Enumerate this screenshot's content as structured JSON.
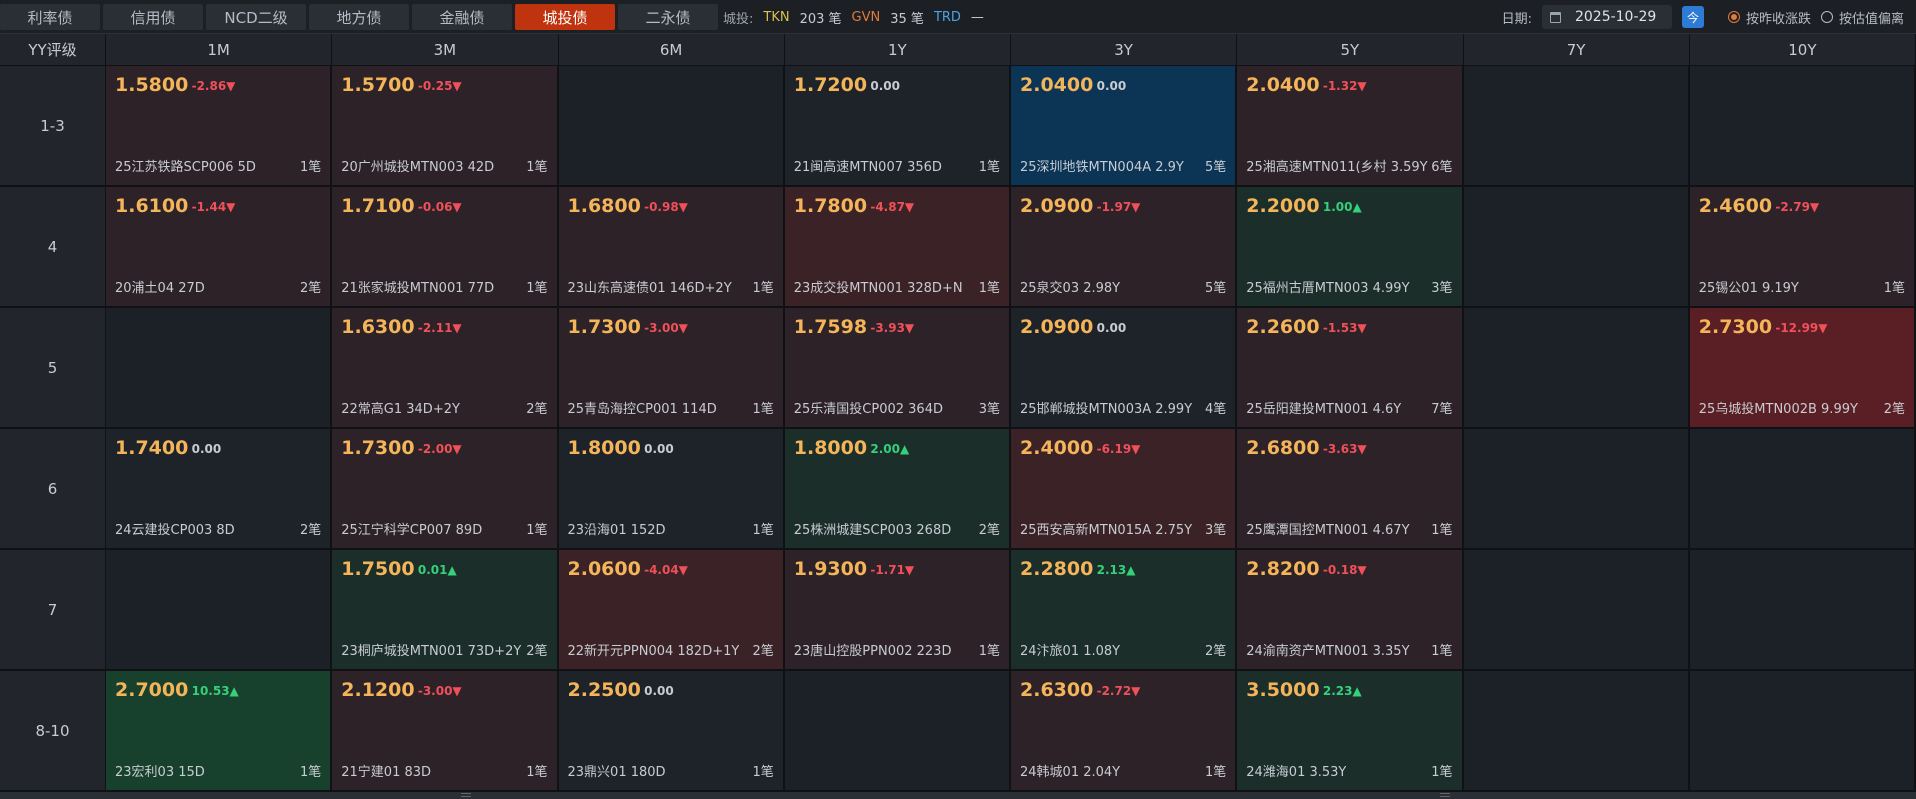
{
  "tabs": [
    {
      "label": "利率债",
      "active": false
    },
    {
      "label": "信用债",
      "active": false
    },
    {
      "label": "NCD二级",
      "active": false
    },
    {
      "label": "地方债",
      "active": false
    },
    {
      "label": "金融债",
      "active": false
    },
    {
      "label": "城投债",
      "active": true
    },
    {
      "label": "二永债",
      "active": false
    }
  ],
  "stats": {
    "label": "城投:",
    "tkn_label": "TKN",
    "tkn_value": "203 笔",
    "gvn_label": "GVN",
    "gvn_value": "35 笔",
    "trd_label": "TRD",
    "trd_value": "—"
  },
  "date": {
    "label": "日期:",
    "value": "2025-10-29",
    "today_label": "今",
    "option1": "按昨收涨跌",
    "option2": "按估值偏离"
  },
  "colors": {
    "accent": "#c0330f",
    "down": "#f0505a",
    "up": "#35d07a",
    "price": "#f4b55a"
  },
  "grid": {
    "corner_label": "YY评级",
    "columns": [
      "1M",
      "3M",
      "6M",
      "1Y",
      "3Y",
      "5Y",
      "7Y",
      "10Y"
    ],
    "rows": [
      {
        "label": "1-3",
        "cells": [
          {
            "val": "1.5800",
            "chg": "-2.86▼",
            "dir": "down",
            "tone": "neg-1",
            "name": "25江苏铁路SCP006 5D",
            "cnt": "1笔"
          },
          {
            "val": "1.5700",
            "chg": "-0.25▼",
            "dir": "down",
            "tone": "neg-1",
            "name": "20广州城投MTN003 42D",
            "cnt": "1笔"
          },
          null,
          {
            "val": "1.7200",
            "chg": "0.00",
            "dir": "flat",
            "tone": "zero",
            "name": "21闽高速MTN007 356D",
            "cnt": "1笔"
          },
          {
            "val": "2.0400",
            "chg": "0.00",
            "dir": "flat",
            "tone": "blue",
            "name": "25深圳地铁MTN004A 2.9Y",
            "cnt": "5笔"
          },
          {
            "val": "2.0400",
            "chg": "-1.32▼",
            "dir": "down",
            "tone": "neg-1",
            "name": "25湘高速MTN011(乡村 3.59Y",
            "cnt": "6笔"
          },
          null,
          null
        ]
      },
      {
        "label": "4",
        "cells": [
          {
            "val": "1.6100",
            "chg": "-1.44▼",
            "dir": "down",
            "tone": "neg-1",
            "name": "20浦土04 27D",
            "cnt": "2笔"
          },
          {
            "val": "1.7100",
            "chg": "-0.06▼",
            "dir": "down",
            "tone": "neg-1",
            "name": "21张家城投MTN001 77D",
            "cnt": "1笔"
          },
          {
            "val": "1.6800",
            "chg": "-0.98▼",
            "dir": "down",
            "tone": "neg-1",
            "name": "23山东高速债01 146D+2Y",
            "cnt": "1笔"
          },
          {
            "val": "1.7800",
            "chg": "-4.87▼",
            "dir": "down",
            "tone": "neg-2",
            "name": "23成交投MTN001 328D+N",
            "cnt": "1笔"
          },
          {
            "val": "2.0900",
            "chg": "-1.97▼",
            "dir": "down",
            "tone": "neg-1",
            "name": "25泉交03 2.98Y",
            "cnt": "5笔"
          },
          {
            "val": "2.2000",
            "chg": "1.00▲",
            "dir": "up",
            "tone": "pos-1",
            "name": "25福州古厝MTN003 4.99Y",
            "cnt": "3笔"
          },
          null,
          {
            "val": "2.4600",
            "chg": "-2.79▼",
            "dir": "down",
            "tone": "neg-1",
            "name": "25锡公01 9.19Y",
            "cnt": "1笔"
          }
        ]
      },
      {
        "label": "5",
        "cells": [
          null,
          {
            "val": "1.6300",
            "chg": "-2.11▼",
            "dir": "down",
            "tone": "neg-1",
            "name": "22常高G1 34D+2Y",
            "cnt": "2笔"
          },
          {
            "val": "1.7300",
            "chg": "-3.00▼",
            "dir": "down",
            "tone": "neg-1",
            "name": "25青岛海控CP001 114D",
            "cnt": "1笔"
          },
          {
            "val": "1.7598",
            "chg": "-3.93▼",
            "dir": "down",
            "tone": "neg-1",
            "name": "25乐清国投CP002 364D",
            "cnt": "3笔"
          },
          {
            "val": "2.0900",
            "chg": "0.00",
            "dir": "flat",
            "tone": "zero",
            "name": "25邯郸城投MTN003A 2.99Y",
            "cnt": "4笔"
          },
          {
            "val": "2.2600",
            "chg": "-1.53▼",
            "dir": "down",
            "tone": "neg-1",
            "name": "25岳阳建投MTN001 4.6Y",
            "cnt": "7笔"
          },
          null,
          {
            "val": "2.7300",
            "chg": "-12.99▼",
            "dir": "down",
            "tone": "neg-3",
            "name": "25乌城投MTN002B 9.99Y",
            "cnt": "2笔"
          }
        ]
      },
      {
        "label": "6",
        "cells": [
          {
            "val": "1.7400",
            "chg": "0.00",
            "dir": "flat",
            "tone": "zero",
            "name": "24云建投CP003 8D",
            "cnt": "2笔"
          },
          {
            "val": "1.7300",
            "chg": "-2.00▼",
            "dir": "down",
            "tone": "neg-1",
            "name": "25江宁科学CP007 89D",
            "cnt": "1笔"
          },
          {
            "val": "1.8000",
            "chg": "0.00",
            "dir": "flat",
            "tone": "zero",
            "name": "23沿海01 152D",
            "cnt": "1笔"
          },
          {
            "val": "1.8000",
            "chg": "2.00▲",
            "dir": "up",
            "tone": "pos-1",
            "name": "25株洲城建SCP003 268D",
            "cnt": "2笔"
          },
          {
            "val": "2.4000",
            "chg": "-6.19▼",
            "dir": "down",
            "tone": "neg-2",
            "name": "25西安高新MTN015A 2.75Y",
            "cnt": "3笔"
          },
          {
            "val": "2.6800",
            "chg": "-3.63▼",
            "dir": "down",
            "tone": "neg-1",
            "name": "25鹰潭国控MTN001 4.67Y",
            "cnt": "1笔"
          },
          null,
          null
        ]
      },
      {
        "label": "7",
        "cells": [
          null,
          {
            "val": "1.7500",
            "chg": "0.01▲",
            "dir": "up",
            "tone": "pos-1",
            "name": "23桐庐城投MTN001 73D+2Y",
            "cnt": "2笔"
          },
          {
            "val": "2.0600",
            "chg": "-4.04▼",
            "dir": "down",
            "tone": "neg-2",
            "name": "22新开元PPN004 182D+1Y",
            "cnt": "2笔"
          },
          {
            "val": "1.9300",
            "chg": "-1.71▼",
            "dir": "down",
            "tone": "neg-1",
            "name": "23唐山控股PPN002 223D",
            "cnt": "1笔"
          },
          {
            "val": "2.2800",
            "chg": "2.13▲",
            "dir": "up",
            "tone": "pos-1",
            "name": "24汴旅01 1.08Y",
            "cnt": "2笔"
          },
          {
            "val": "2.8200",
            "chg": "-0.18▼",
            "dir": "down",
            "tone": "neg-1",
            "name": "24渝南资产MTN001 3.35Y",
            "cnt": "1笔"
          },
          null,
          null
        ]
      },
      {
        "label": "8-10",
        "cells": [
          {
            "val": "2.7000",
            "chg": "10.53▲",
            "dir": "up",
            "tone": "pos-2",
            "name": "23宏利03 15D",
            "cnt": "1笔"
          },
          {
            "val": "2.1200",
            "chg": "-3.00▼",
            "dir": "down",
            "tone": "neg-1",
            "name": "21宁建01 83D",
            "cnt": "1笔"
          },
          {
            "val": "2.2500",
            "chg": "0.00",
            "dir": "flat",
            "tone": "zero",
            "name": "23鼎兴01 180D",
            "cnt": "1笔"
          },
          null,
          {
            "val": "2.6300",
            "chg": "-2.72▼",
            "dir": "down",
            "tone": "neg-1",
            "name": "24韩城01 2.04Y",
            "cnt": "1笔"
          },
          {
            "val": "3.5000",
            "chg": "2.23▲",
            "dir": "up",
            "tone": "pos-1",
            "name": "24潍海01 3.53Y",
            "cnt": "1笔"
          },
          null,
          null
        ]
      }
    ]
  }
}
